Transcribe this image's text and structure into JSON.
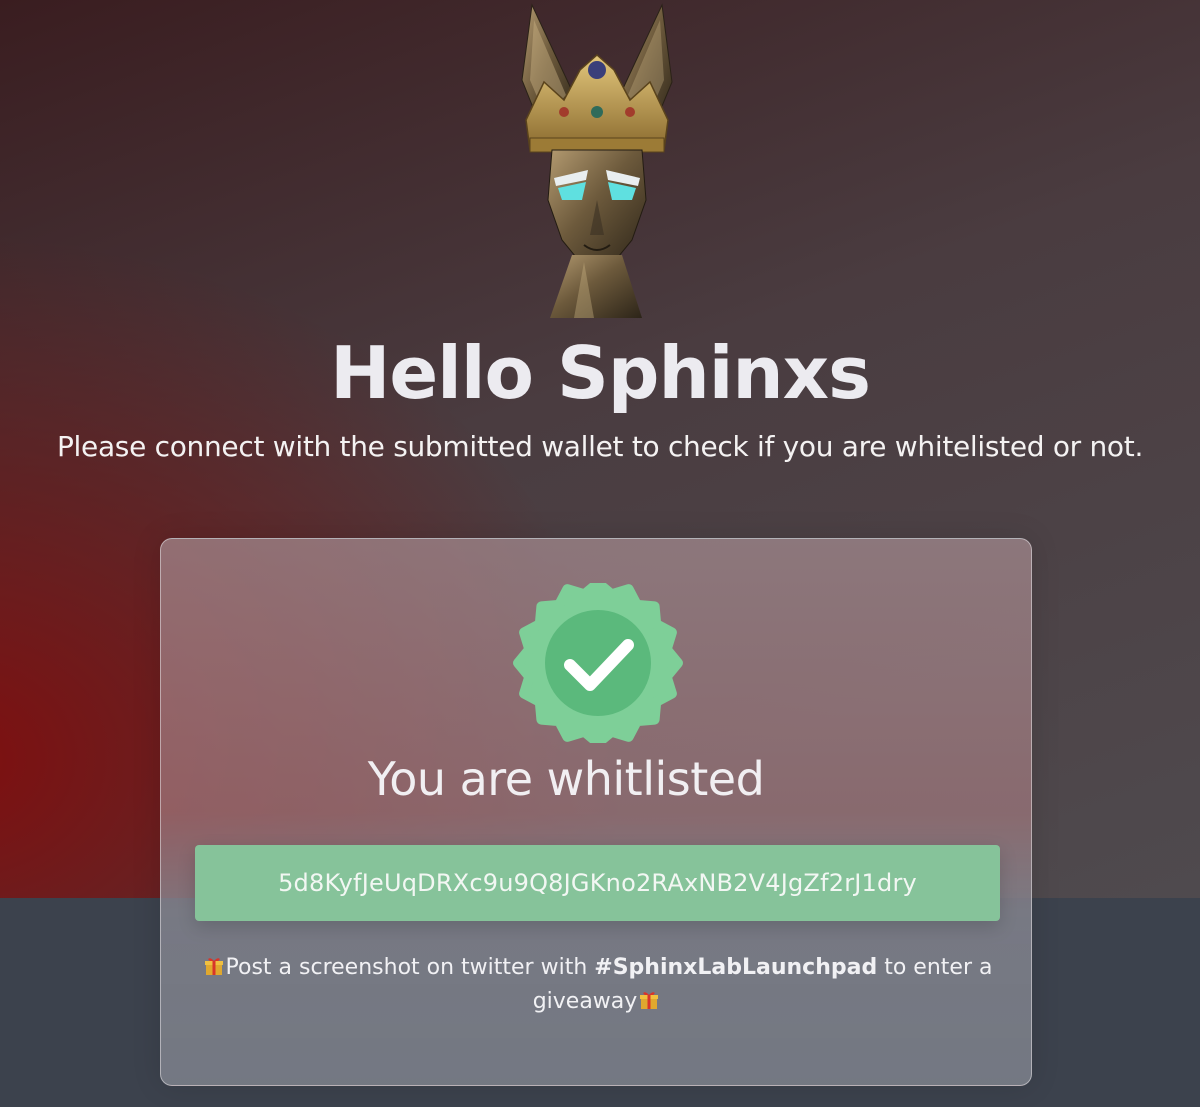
{
  "header": {
    "title": "Hello Sphinxs",
    "subtitle": "Please connect with the submitted wallet to check if you are whitelisted or not."
  },
  "result_card": {
    "status_text": "You are whitlisted",
    "wallet_address": "5d8KyfJeUqDRXc9u9Q8JGKno2RAxNB2V4JgZf2rJ1dry",
    "note_prefix": "Post a screenshot on twitter with",
    "hashtag": "#SphinxLabLaunchpad",
    "note_suffix": "to enter a giveaway"
  },
  "icons": {
    "mascot": "crowned-sphinx-cat-image",
    "badge": "verified-check-icon",
    "gift": "gift-icon"
  },
  "colors": {
    "badge_green": "#7ecf98",
    "wallet_green": "#86c39a",
    "text_light": "#ecebf0"
  }
}
